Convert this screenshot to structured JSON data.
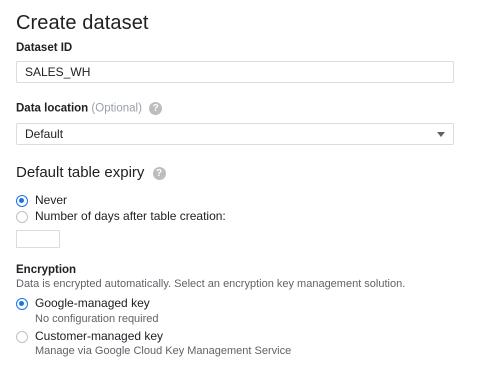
{
  "page": {
    "title": "Create dataset"
  },
  "dataset_id": {
    "label": "Dataset ID",
    "value": "SALES_WH"
  },
  "data_location": {
    "label": "Data location",
    "optional": "(Optional)",
    "value": "Default",
    "help_icon": "help-icon"
  },
  "expiry": {
    "heading": "Default table expiry",
    "options": [
      {
        "label": "Never",
        "checked": true
      },
      {
        "label": "Number of days after table creation:",
        "checked": false
      }
    ],
    "days_value": ""
  },
  "encryption": {
    "heading": "Encryption",
    "description": "Data is encrypted automatically. Select an encryption key management solution.",
    "options": [
      {
        "label": "Google-managed key",
        "sub": "No configuration required",
        "checked": true
      },
      {
        "label": "Customer-managed key",
        "sub": "Manage via Google Cloud Key Management Service",
        "checked": false
      }
    ]
  },
  "colors": {
    "accent": "#1a73e8",
    "border": "#dadce0",
    "muted": "#5f6368"
  }
}
